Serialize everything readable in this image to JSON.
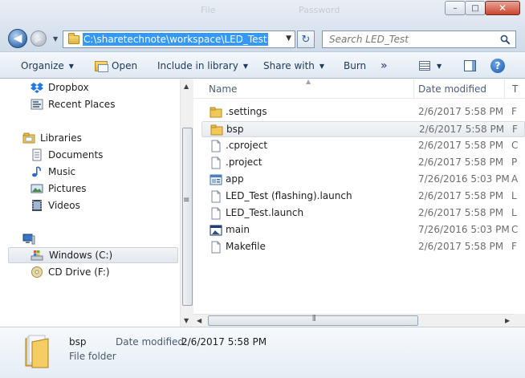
{
  "titlebar": {
    "ghost_left": "File",
    "ghost_right": "Password",
    "buttons": {
      "minimize": "–",
      "maximize": "□",
      "close": "✕"
    }
  },
  "address": {
    "path": "C:\\sharetechnote\\workspace\\LED_Test",
    "search_placeholder": "Search LED_Test"
  },
  "toolbar": {
    "organize": "Organize",
    "open": "Open",
    "include_in_library": "Include in library",
    "share_with": "Share with",
    "burn": "Burn",
    "more": "»"
  },
  "navpane": {
    "favorites": [
      {
        "label": "Dropbox",
        "icon": "dropbox-icon"
      },
      {
        "label": "Recent Places",
        "icon": "recent-places-icon"
      }
    ],
    "libraries_label": "Libraries",
    "libraries": [
      {
        "label": "Documents",
        "icon": "documents-icon"
      },
      {
        "label": "Music",
        "icon": "music-icon"
      },
      {
        "label": "Pictures",
        "icon": "pictures-icon"
      },
      {
        "label": "Videos",
        "icon": "videos-icon"
      }
    ],
    "drives": [
      {
        "label": "Windows (C:)",
        "icon": "windows-drive-icon"
      },
      {
        "label": "CD Drive (F:)",
        "icon": "cd-drive-icon"
      }
    ]
  },
  "filelist": {
    "columns": {
      "name": "Name",
      "date": "Date modified"
    },
    "rows": [
      {
        "name": ".settings",
        "date": "2/6/2017 5:58 PM",
        "extra": "F",
        "icon": "folder-icon"
      },
      {
        "name": "bsp",
        "date": "2/6/2017 5:58 PM",
        "extra": "F",
        "icon": "folder-icon"
      },
      {
        "name": ".cproject",
        "date": "2/6/2017 5:58 PM",
        "extra": "C",
        "icon": "file-icon"
      },
      {
        "name": ".project",
        "date": "2/6/2017 5:58 PM",
        "extra": "P",
        "icon": "file-icon"
      },
      {
        "name": "app",
        "date": "7/26/2016 5:03 PM",
        "extra": "A",
        "icon": "app-icon"
      },
      {
        "name": "LED_Test (flashing).launch",
        "date": "2/6/2017 5:58 PM",
        "extra": "L",
        "icon": "file-icon"
      },
      {
        "name": "LED_Test.launch",
        "date": "2/6/2017 5:58 PM",
        "extra": "L",
        "icon": "file-icon"
      },
      {
        "name": "main",
        "date": "7/26/2016 5:03 PM",
        "extra": "C",
        "icon": "exe-icon"
      },
      {
        "name": "Makefile",
        "date": "2/6/2017 5:58 PM",
        "extra": "F",
        "icon": "file-icon"
      }
    ]
  },
  "details": {
    "name": "bsp",
    "type": "File folder",
    "date_label": "Date modified:",
    "date_value": "2/6/2017 5:58 PM"
  },
  "colors": {
    "selection": "#3399ff",
    "toolbar_text": "#1e395b"
  }
}
